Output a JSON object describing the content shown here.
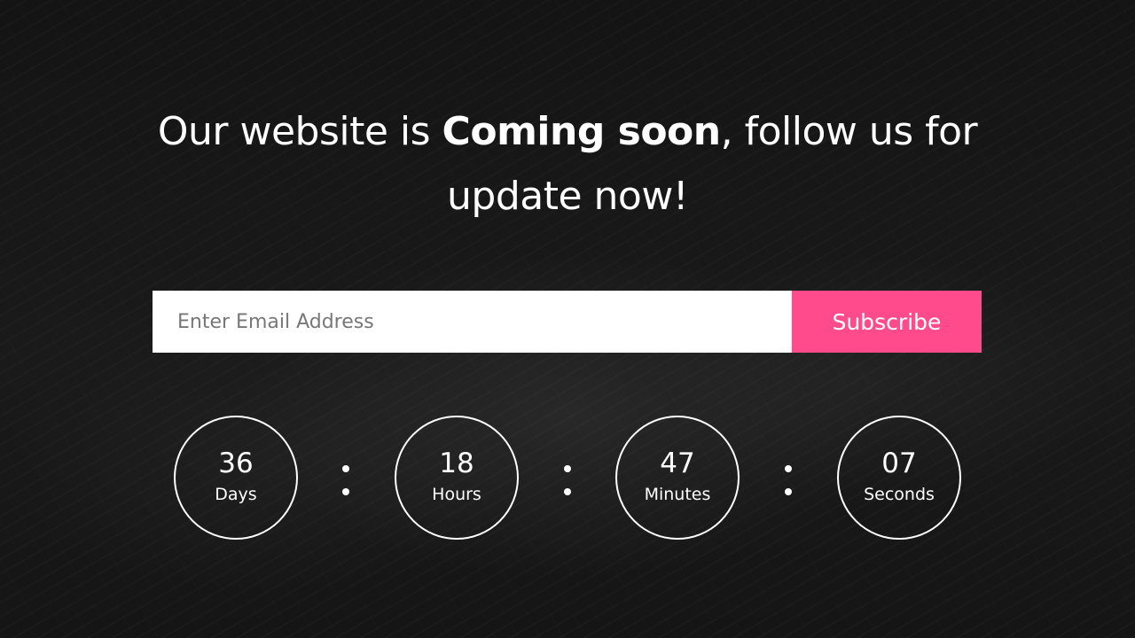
{
  "headline": {
    "part1": "Our website is ",
    "emphasis": "Coming soon",
    "part2": ", follow us for update now!"
  },
  "subscribe": {
    "placeholder": "Enter Email Address",
    "value": "",
    "button_label": "Subscribe"
  },
  "countdown": {
    "days": {
      "value": "36",
      "label": "Days"
    },
    "hours": {
      "value": "18",
      "label": "Hours"
    },
    "minutes": {
      "value": "47",
      "label": "Minutes"
    },
    "seconds": {
      "value": "07",
      "label": "Seconds"
    }
  },
  "colors": {
    "accent": "#ff4b8c",
    "background": "#161616",
    "text": "#ffffff"
  }
}
